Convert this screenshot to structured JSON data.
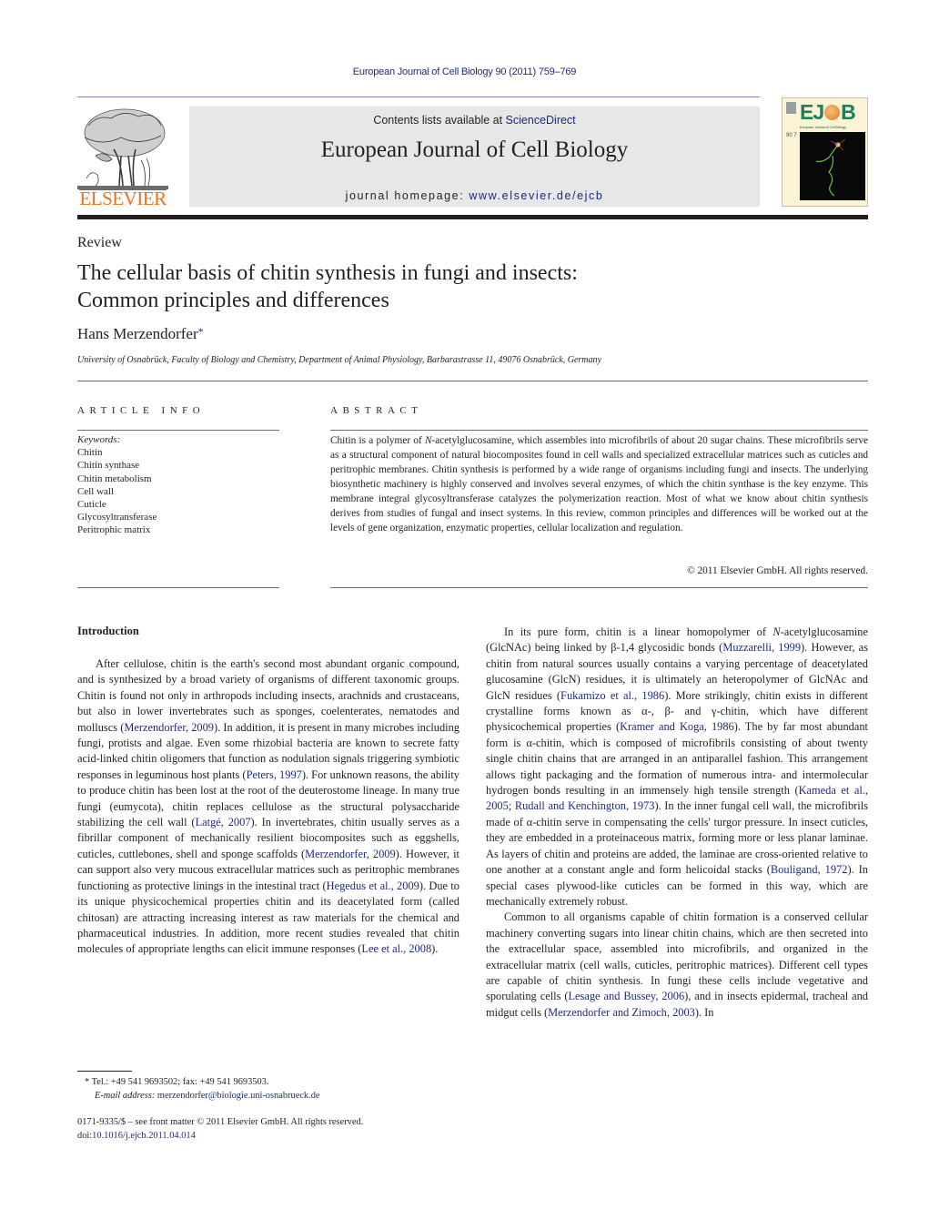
{
  "journal_reference": "European Journal of Cell Biology 90 (2011) 759–769",
  "header": {
    "publisher_logo_text": "ELSEVIER",
    "contents_prefix": "Contents lists available at ",
    "contents_link": "ScienceDirect",
    "journal_title": "European Journal of Cell Biology",
    "homepage_prefix": "journal homepage: ",
    "homepage_link": "www.elsevier.de/ejcb",
    "cover": {
      "title_left": "EJ",
      "title_right": "B",
      "subtitle": "European Journal of Cell Biology",
      "issue": "90 7"
    }
  },
  "colors": {
    "link": "#1f2a7a",
    "elsevier_orange": "#e9711c",
    "banner_gray": "#e6e7e8",
    "cover_green": "#1a7f5a"
  },
  "article": {
    "type": "Review",
    "title_line1": "The cellular basis of chitin synthesis in fungi and insects:",
    "title_line2": "Common principles and differences",
    "author": "Hans Merzendorfer",
    "author_mark": "*",
    "affiliation": "University of Osnabrück, Faculty of Biology and Chemistry, Department of Animal Physiology, Barbarastrasse 11, 49076 Osnabrück, Germany"
  },
  "article_info": {
    "heading": "ARTICLE INFO",
    "keywords_label": "Keywords:",
    "keywords": [
      "Chitin",
      "Chitin synthase",
      "Chitin metabolism",
      "Cell wall",
      "Cuticle",
      "Glycosyltransferase",
      "Peritrophic matrix"
    ]
  },
  "abstract": {
    "heading": "ABSTRACT",
    "text_part1": "Chitin is a polymer of ",
    "text_italic": "N",
    "text_part2": "-acetylglucosamine, which assembles into microfibrils of about 20 sugar chains. These microfibrils serve as a structural component of natural biocomposites found in cell walls and specialized extracellular matrices such as cuticles and peritrophic membranes. Chitin synthesis is performed by a wide range of organisms including fungi and insects. The underlying biosynthetic machinery is highly conserved and involves several enzymes, of which the chitin synthase is the key enzyme. This membrane integral glycosyltransferase catalyzes the polymerization reaction. Most of what we know about chitin synthesis derives from studies of fungal and insect systems. In this review, common principles and differences will be worked out at the levels of gene organization, enzymatic properties, cellular localization and regulation.",
    "copyright": "© 2011 Elsevier GmbH. All rights reserved."
  },
  "introduction": {
    "heading": "Introduction",
    "left_paragraph": [
      {
        "t": "After cellulose, chitin is the earth's second most abundant organic compound, and is synthesized by a broad variety of organisms of different taxonomic groups. Chitin is found not only in arthropods including insects, arachnids and crustaceans, but also in lower invertebrates such as sponges, coelenterates, nematodes and molluscs ("
      },
      {
        "ref": "Merzendorfer, 2009"
      },
      {
        "t": "). In addition, it is present in many microbes including fungi, protists and algae. Even some rhizobial bacteria are known to secrete fatty acid-linked chitin oligomers that function as nodulation signals triggering symbiotic responses in leguminous host plants ("
      },
      {
        "ref": "Peters, 1997"
      },
      {
        "t": "). For unknown reasons, the ability to produce chitin has been lost at the root of the deuterostome lineage. In many true fungi (eumycota), chitin replaces cellulose as the structural polysaccharide stabilizing the cell wall ("
      },
      {
        "ref": "Latgé, 2007"
      },
      {
        "t": "). In invertebrates, chitin usually serves as a fibrillar component of mechanically resilient biocomposites such as eggshells, cuticles, cuttlebones, shell and sponge scaffolds ("
      },
      {
        "ref": "Merzendorfer, 2009"
      },
      {
        "t": "). However, it can support also very mucous extracellular matrices such as peritrophic membranes functioning as protective linings in the intestinal tract ("
      },
      {
        "ref": "Hegedus et al., 2009"
      },
      {
        "t": "). Due to its unique physicochemical properties chitin and its deacetylated form (called chitosan) are attracting increasing interest as raw materials for the chemical and pharmaceutical industries. In addition, more recent studies revealed that chitin molecules of appropriate lengths can elicit immune responses ("
      },
      {
        "ref": "Lee et al., 2008"
      },
      {
        "t": ")."
      }
    ],
    "right_paragraph1": [
      {
        "t": "In its pure form, chitin is a linear homopolymer of "
      },
      {
        "i": "N"
      },
      {
        "t": "-acetylglucosamine (GlcNAc) being linked by β-1,4 glycosidic bonds ("
      },
      {
        "ref": "Muzzarelli, 1999"
      },
      {
        "t": "). However, as chitin from natural sources usually contains a varying percentage of deacetylated glucosamine (GlcN) residues, it is ultimately an heteropolymer of GlcNAc and GlcN residues ("
      },
      {
        "ref": "Fukamizo et al., 1986"
      },
      {
        "t": "). More strikingly, chitin exists in different crystalline forms known as α-, β- and γ-chitin, which have different physicochemical properties ("
      },
      {
        "ref": "Kramer and Koga, 1986"
      },
      {
        "t": "). The by far most abundant form is α-chitin, which is composed of microfibrils consisting of about twenty single chitin chains that are arranged in an antiparallel fashion. This arrangement allows tight packaging and the formation of numerous intra- and intermolecular hydrogen bonds resulting in an immensely high tensile strength ("
      },
      {
        "ref": "Kameda et al., 2005; Rudall and Kenchington, 1973"
      },
      {
        "t": "). In the inner fungal cell wall, the microfibrils made of α-chitin serve in compensating the cells' turgor pressure. In insect cuticles, they are embedded in a proteinaceous matrix, forming more or less planar laminae. As layers of chitin and proteins are added, the laminae are cross-oriented relative to one another at a constant angle and form helicoidal stacks ("
      },
      {
        "ref": "Bouligand, 1972"
      },
      {
        "t": "). In special cases plywood-like cuticles can be formed in this way, which are mechanically extremely robust."
      }
    ],
    "right_paragraph2": [
      {
        "t": "Common to all organisms capable of chitin formation is a conserved cellular machinery converting sugars into linear chitin chains, which are then secreted into the extracellular space, assembled into microfibrils, and organized in the extracellular matrix (cell walls, cuticles, peritrophic matrices). Different cell types are capable of chitin synthesis. In fungi these cells include vegetative and sporulating cells ("
      },
      {
        "ref": "Lesage and Bussey, 2006"
      },
      {
        "t": "), and in insects epidermal, tracheal and midgut cells ("
      },
      {
        "ref": "Merzendorfer and Zimoch, 2003"
      },
      {
        "t": "). In"
      }
    ]
  },
  "footnote": {
    "mark": "*",
    "contact": "Tel.: +49 541 9693502; fax: +49 541 9693503.",
    "email_label": "E-mail address:",
    "email": "merzendorfer@biologie.uni-osnabrueck.de"
  },
  "front_matter": {
    "issn_line": "0171-9335/$ – see front matter © 2011 Elsevier GmbH. All rights reserved.",
    "doi_prefix": "doi:",
    "doi": "10.1016/j.ejcb.2011.04.014"
  }
}
